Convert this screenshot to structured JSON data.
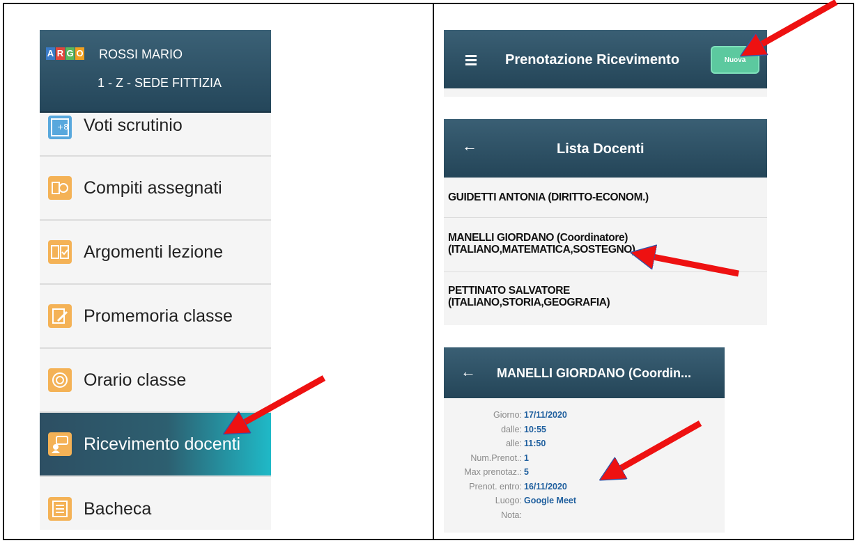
{
  "left_menu": {
    "logo_letters": [
      {
        "letter": "A",
        "color": "#3a7bc8"
      },
      {
        "letter": "R",
        "color": "#e1473d"
      },
      {
        "letter": "G",
        "color": "#5bb85b"
      },
      {
        "letter": "O",
        "color": "#f0a020"
      }
    ],
    "user_name": "ROSSI MARIO",
    "class_name": "1 - Z - SEDE FITTIZIA",
    "items": [
      {
        "label": "Voti scrutinio",
        "icon": "grades-icon"
      },
      {
        "label": "Compiti assegnati",
        "icon": "book-icon"
      },
      {
        "label": "Argomenti lezione",
        "icon": "checklist-icon"
      },
      {
        "label": "Promemoria classe",
        "icon": "note-pencil-icon"
      },
      {
        "label": "Orario classe",
        "icon": "clock-icon"
      },
      {
        "label": "Ricevimento docenti",
        "icon": "meeting-icon",
        "active": true
      },
      {
        "label": "Bacheca",
        "icon": "board-icon"
      }
    ]
  },
  "prenotazione": {
    "title": "Prenotazione Ricevimento",
    "new_button": "Nuova"
  },
  "lista_docenti": {
    "title": "Lista Docenti",
    "rows": [
      {
        "line1": "GUIDETTI ANTONIA (DIRITTO-ECONOM.)",
        "line2": ""
      },
      {
        "line1": "MANELLI GIORDANO (Coordinatore)",
        "line2": "(ITALIANO,MATEMATICA,SOSTEGNO)"
      },
      {
        "line1": "PETTINATO SALVATORE",
        "line2": "(ITALIANO,STORIA,GEOGRAFIA)"
      }
    ]
  },
  "detail": {
    "title": "MANELLI GIORDANO (Coordin...",
    "fields": [
      {
        "key": "Giorno:",
        "value": "17/11/2020"
      },
      {
        "key": "dalle:",
        "value": "10:55"
      },
      {
        "key": "alle:",
        "value": "11:50"
      },
      {
        "key": "Num.Prenot.:",
        "value": "1"
      },
      {
        "key": "Max prenotaz.:",
        "value": "5"
      },
      {
        "key": "Prenot. entro:",
        "value": "16/11/2020"
      },
      {
        "key": "Luogo:",
        "value": "Google Meet"
      },
      {
        "key": "Nota:",
        "value": ""
      }
    ]
  },
  "colors": {
    "header": "#2f5468",
    "accent_teal": "#1fb9c7",
    "button_green": "#5cc99f",
    "arrow_red": "#ee1111",
    "link_blue": "#1f5f9e"
  }
}
